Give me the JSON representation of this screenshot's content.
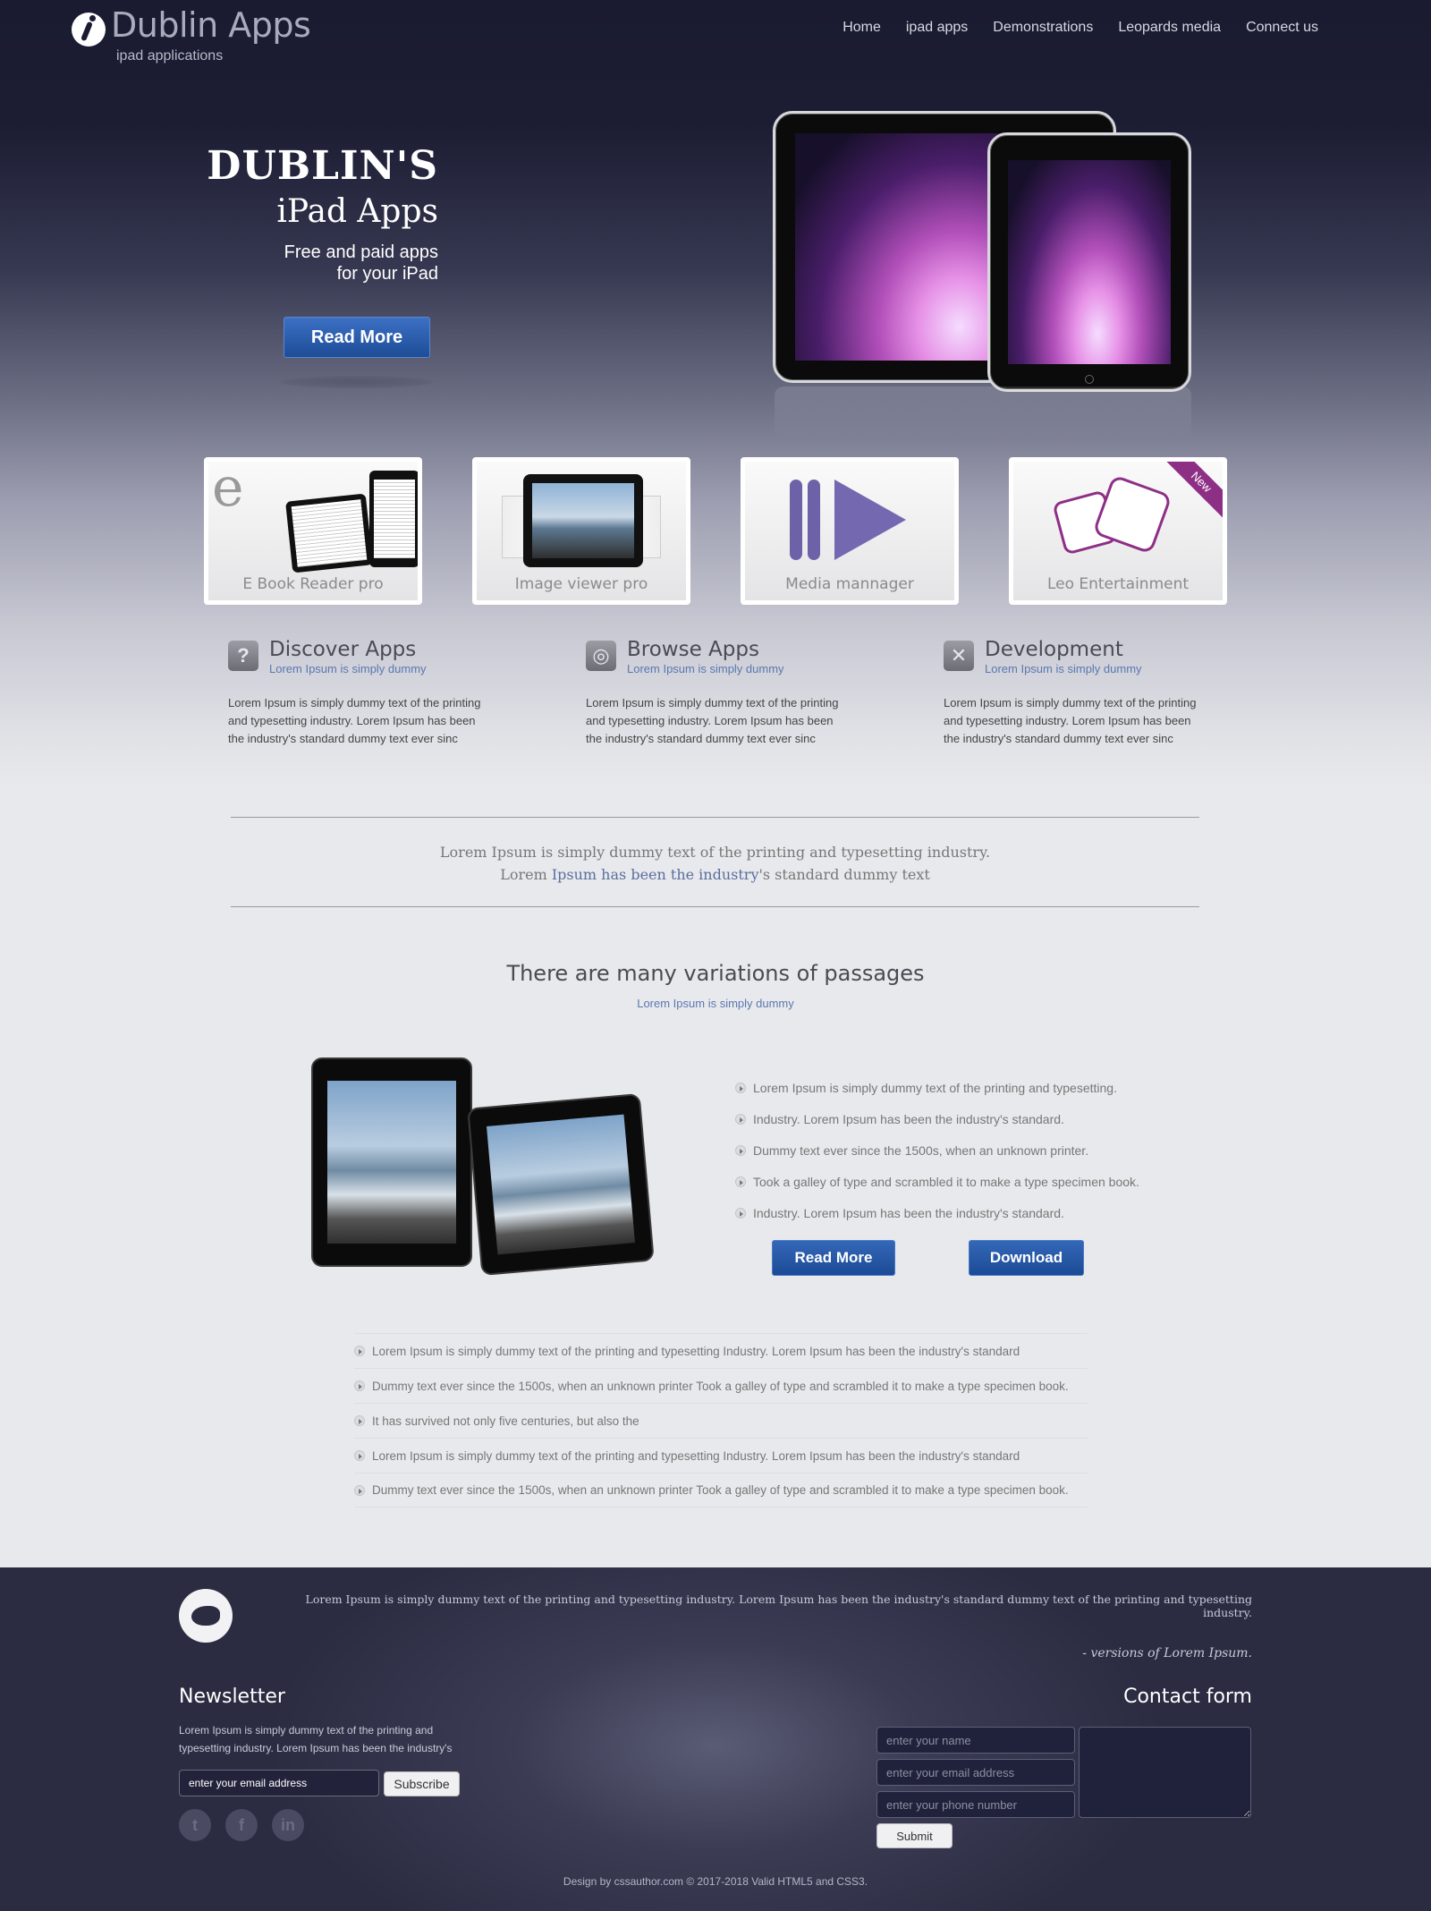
{
  "header": {
    "title": "Dublin Apps",
    "subtitle": "ipad applications",
    "nav": [
      "Home",
      "ipad apps",
      "Demonstrations",
      "Leopards media",
      "Connect us"
    ]
  },
  "hero": {
    "line1": "DUBLIN'S",
    "line2": "iPad Apps",
    "line3": "Free and paid apps",
    "line4": "for your iPad",
    "button": "Read More"
  },
  "apps": [
    {
      "label": "E Book Reader pro",
      "icon": "ebook-icon"
    },
    {
      "label": "Image viewer pro",
      "icon": "image-viewer-icon"
    },
    {
      "label": "Media mannager",
      "icon": "media-icon"
    },
    {
      "label": "Leo Entertainment",
      "icon": "dice-icon",
      "badge": "New"
    }
  ],
  "features": [
    {
      "title": "Discover Apps",
      "sub": "Lorem Ipsum is simply dummy",
      "icon": "?",
      "body": "Lorem Ipsum is simply dummy text of the printing and typesetting industry. Lorem Ipsum has been the industry's standard dummy text ever sinc"
    },
    {
      "title": "Browse Apps",
      "sub": "Lorem Ipsum is simply dummy",
      "icon": "◎",
      "body": "Lorem Ipsum is simply dummy text of the printing and typesetting industry. Lorem Ipsum has been the industry's standard dummy text ever sinc"
    },
    {
      "title": "Development",
      "sub": "Lorem Ipsum is simply dummy",
      "icon": "✕",
      "body": "Lorem Ipsum is simply dummy text of the printing and typesetting industry. Lorem Ipsum has been the industry's standard dummy text ever sinc"
    }
  ],
  "quote": {
    "line1": "Lorem Ipsum is simply dummy text of the printing and typesetting industry.",
    "line2_a": "Lorem ",
    "line2_b": "Ipsum has been the industry",
    "line2_c": "'s standard dummy text"
  },
  "section": {
    "title": "There are many variations of passages",
    "sub": "Lorem Ipsum is simply dummy",
    "bullets": [
      "Lorem Ipsum is simply dummy text of the printing and typesetting.",
      "Industry. Lorem Ipsum has been the industry's standard.",
      "Dummy text ever since the 1500s, when an unknown printer.",
      "Took a galley of type and scrambled it to make a type specimen book.",
      "Industry. Lorem Ipsum has been the industry's standard."
    ],
    "read_more": "Read More",
    "download": "Download"
  },
  "lower_list": [
    "Lorem Ipsum is simply dummy text of the printing and typesetting Industry. Lorem Ipsum has been the industry's standard",
    "Dummy text ever since the 1500s, when an unknown printer Took a galley of type and scrambled it to make a type specimen book.",
    "It has survived not only five centuries, but also the",
    "Lorem Ipsum is simply dummy text of the printing and typesetting Industry. Lorem Ipsum has been the industry's standard",
    "Dummy text ever since the 1500s, when an unknown printer Took a galley of type and scrambled it to make a type specimen book."
  ],
  "footer": {
    "tweet": "Lorem Ipsum is simply dummy text of the printing and typesetting industry. Lorem Ipsum has been the industry's standard dummy text of the printing and typesetting industry.",
    "tweet_sign": "- versions of Lorem Ipsum.",
    "newsletter_title": "Newsletter",
    "newsletter_text": "Lorem Ipsum is simply dummy text of the printing and typesetting industry. Lorem Ipsum has been the industry's",
    "email_placeholder": "enter your email address",
    "subscribe": "Subscribe",
    "social": [
      "twitter-icon",
      "facebook-icon",
      "linkedin-icon"
    ],
    "contact_title": "Contact form",
    "name_placeholder": "enter your name",
    "contact_email_placeholder": "enter your email address",
    "phone_placeholder": "enter your phone number",
    "submit": "Submit",
    "credit": "Design by cssauthor.com © 2017-2018 Valid HTML5 and CSS3."
  }
}
